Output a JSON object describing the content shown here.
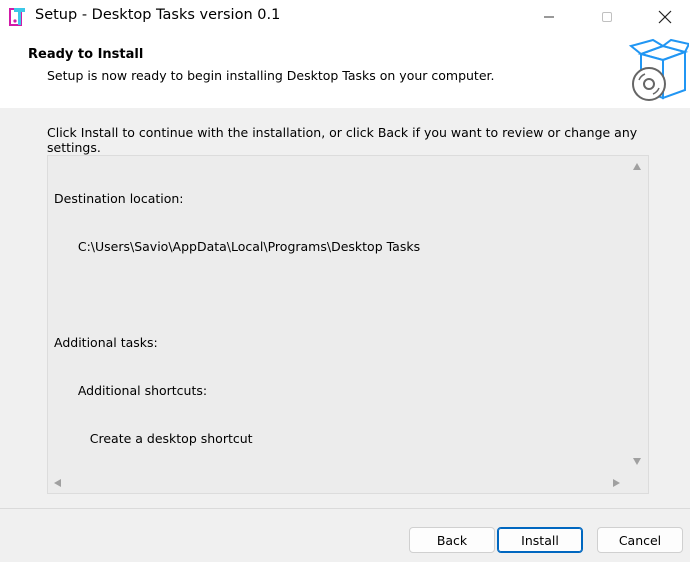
{
  "window": {
    "title": "Setup - Desktop Tasks version 0.1",
    "controls": [
      "minimize-icon",
      "maximize-icon",
      "close-icon"
    ]
  },
  "header": {
    "heading": "Ready to Install",
    "subheading": "Setup is now ready to begin installing Desktop Tasks on your computer.",
    "image_icon": "box-with-disc-icon"
  },
  "main": {
    "instruction": "Click Install to continue with the installation, or click Back if you want to review or change any settings.",
    "memo_lines": [
      "Destination location:",
      "      C:\\Users\\Savio\\AppData\\Local\\Programs\\Desktop Tasks",
      "",
      "Additional tasks:",
      "      Additional shortcuts:",
      "         Create a desktop shortcut"
    ]
  },
  "buttons": {
    "back": "Back",
    "install": "Install",
    "cancel": "Cancel"
  },
  "colors": {
    "accent": "#0067c0",
    "background": "#f0f0f0",
    "header_bg": "#ffffff",
    "icon_blue": "#1e88e5",
    "icon_magenta": "#d11aa8"
  }
}
